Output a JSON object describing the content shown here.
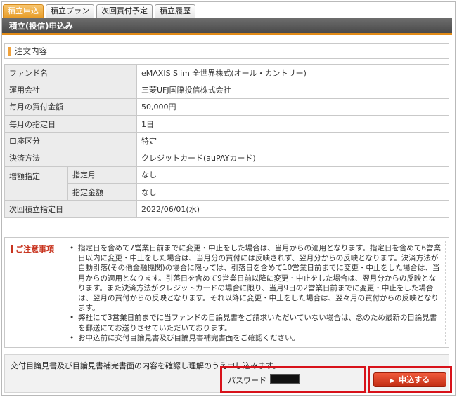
{
  "tabs": [
    {
      "label": "積立申込",
      "active": true
    },
    {
      "label": "積立プラン",
      "active": false
    },
    {
      "label": "次回買付予定",
      "active": false
    },
    {
      "label": "積立履歴",
      "active": false
    }
  ],
  "page_title": "積立(投信)申込み",
  "section_title": "注文内容",
  "order": {
    "fund_name_label": "ファンド名",
    "fund_name": "eMAXIS Slim 全世界株式(オール・カントリー)",
    "company_label": "運用会社",
    "company": "三菱UFJ国際投信株式会社",
    "amount_label": "毎月の買付金額",
    "amount": "50,000円",
    "day_label": "毎月の指定日",
    "day": "1日",
    "account_label": "口座区分",
    "account": "特定",
    "payment_label": "決済方法",
    "payment": "クレジットカード(auPAYカード)",
    "increase_label": "増額指定",
    "increase_month_label": "指定月",
    "increase_month": "なし",
    "increase_amount_label": "指定金額",
    "increase_amount": "なし",
    "next_date_label": "次回積立指定日",
    "next_date": "2022/06/01(水)"
  },
  "notes": {
    "title": "ご注意事項",
    "items": [
      "指定日を含めて7営業日前までに変更・中止をした場合は、当月からの適用となります。指定日を含めて6営業日以内に変更・中止をした場合は、当月分の買付には反映されず、翌月分からの反映となります。決済方法が自動引落(その他金融機関)の場合に限っては、引落日を含めて10営業日前までに変更・中止をした場合は、当月からの適用となります。引落日を含めて9営業日前以降に変更・中止をした場合は、翌月分からの反映となります。また決済方法がクレジットカードの場合に限り、当月9日の2営業日前までに変更・中止をした場合は、翌月の買付からの反映となります。それ以降に変更・中止をした場合は、翌々月の買付からの反映となります。",
      "弊社にて3営業日前までに当ファンドの目論見書をご請求いただいていない場合は、念のため最新の目論見書を郵送にてお送りさせていただいております。",
      "お申込前に交付目論見書及び目論見書補完書面をご確認ください。"
    ]
  },
  "confirm_text": "交付目論見書及び目論見書補完書面の内容を確認し理解のうえ申し込みます。",
  "password_label": "パスワード",
  "submit_label": "申込する",
  "colors": {
    "accent_orange": "#e79b26",
    "title_bar": "#555555",
    "highlight_red": "#d8121a",
    "submit_red": "#c22d14",
    "notes_title": "#c8341f"
  }
}
